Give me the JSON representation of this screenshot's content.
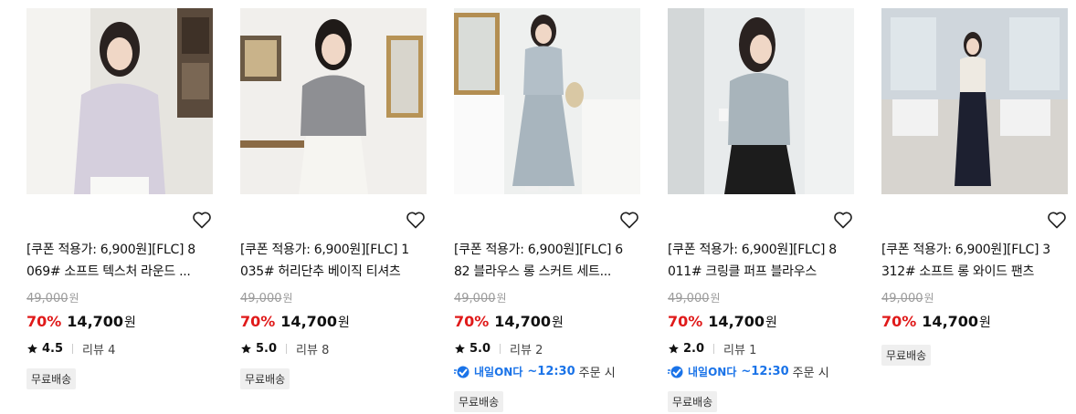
{
  "products": [
    {
      "title_line1": "[쿠폰 적용가: 6,900원][FLC] 8",
      "title_line2": "069# 소프트 텍스처 라운드 ...",
      "original_price": "49,000",
      "currency_small": "원",
      "discount": "70%",
      "price": "14,700",
      "currency": "원",
      "rating": "4.5",
      "reviews": "리뷰 4",
      "delivery": null,
      "badge": "무료배송",
      "colors": {
        "garment": "#d5cfdd",
        "bg": "#e6e4df"
      }
    },
    {
      "title_line1": "[쿠폰 적용가: 6,900원][FLC] 1",
      "title_line2": "035# 허리단추 베이직 티셔츠",
      "original_price": "49,000",
      "currency_small": "원",
      "discount": "70%",
      "price": "14,700",
      "currency": "원",
      "rating": "5.0",
      "reviews": "리뷰 8",
      "delivery": null,
      "badge": "무료배송",
      "colors": {
        "garment": "#8e8f93",
        "bg": "#f1efec"
      }
    },
    {
      "title_line1": "[쿠폰 적용가: 6,900원][FLC] 6",
      "title_line2": "82 블라우스 롱 스커트 세트...",
      "original_price": "49,000",
      "currency_small": "원",
      "discount": "70%",
      "price": "14,700",
      "currency": "원",
      "rating": "5.0",
      "reviews": "리뷰 2",
      "delivery": {
        "logo": "내일ON다",
        "time": "~12:30",
        "order": "주문 시"
      },
      "badge": "무료배송",
      "colors": {
        "garment": "#b3bfc8",
        "bg": "#eef0ef"
      }
    },
    {
      "title_line1": "[쿠폰 적용가: 6,900원][FLC] 8",
      "title_line2": "011# 크링클 퍼프 블라우스",
      "original_price": "49,000",
      "currency_small": "원",
      "discount": "70%",
      "price": "14,700",
      "currency": "원",
      "rating": "2.0",
      "reviews": "리뷰 1",
      "delivery": {
        "logo": "내일ON다",
        "time": "~12:30",
        "order": "주문 시"
      },
      "badge": "무료배송",
      "colors": {
        "garment": "#a8b4bb",
        "bg": "#e8ebec"
      }
    },
    {
      "title_line1": "[쿠폰 적용가: 6,900원][FLC] 3",
      "title_line2": "312# 소프트 롱 와이드 팬츠",
      "original_price": "49,000",
      "currency_small": "원",
      "discount": "70%",
      "price": "14,700",
      "currency": "원",
      "rating": null,
      "reviews": null,
      "delivery": null,
      "badge": "무료배송",
      "colors": {
        "garment": "#1d2030",
        "bg": "#e6e8ea"
      }
    }
  ],
  "icons": {
    "wish": "heart-outline-icon",
    "star": "star-icon",
    "delivery": "delivery-truck-icon"
  },
  "accent_colors": {
    "discount": "#e01a1a",
    "delivery": "#1a73e8"
  }
}
